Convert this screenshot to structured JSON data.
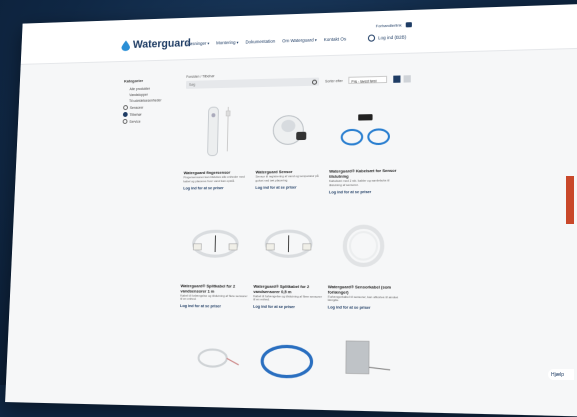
{
  "header": {
    "brand": "Waterguard",
    "nav": [
      {
        "label": "Løsninger",
        "caret": "▾"
      },
      {
        "label": "Montering",
        "caret": "▾"
      },
      {
        "label": "Dokumentation",
        "caret": ""
      },
      {
        "label": "Om Waterguard",
        "caret": "▾"
      },
      {
        "label": "Kontakt Os",
        "caret": ""
      }
    ],
    "util_link": "Forhandlerlink",
    "login_label": "Log ind (B2B)"
  },
  "breadcrumb": "Forsiden / Tilbehør",
  "sidebar": {
    "heading": "Kategorier",
    "items": [
      {
        "label": "Alle produkter",
        "indent": true,
        "selected": false
      },
      {
        "label": "Vandstopper",
        "indent": true,
        "selected": false
      },
      {
        "label": "Til udvidelsesenheder",
        "indent": true,
        "selected": false
      },
      {
        "label": "Sensorer",
        "indent": false,
        "selected": false
      },
      {
        "label": "Tilbehør",
        "indent": false,
        "selected": true
      },
      {
        "label": "Service",
        "indent": false,
        "selected": false
      }
    ]
  },
  "toolbar": {
    "search_placeholder": "Søg",
    "sort_label": "Sorter efter",
    "sort_value": "Pris - lavest først"
  },
  "products": [
    {
      "title": "Waterguard fingersensor",
      "desc": "Fingersensoren kan tilsluttes alle enheder med kabel og placeres hvor vand kan opstå.",
      "login": "Log ind for at se priser",
      "image": "finger-sensor"
    },
    {
      "title": "Waterguard Sensor",
      "desc": "Sensor til registrering af vand og temperatur på gulvet ved tæt placering.",
      "login": "Log ind for at se priser",
      "image": "round-sensor"
    },
    {
      "title": "Waterguard® Kabelsæt for Sensor tilslutning",
      "desc": "Kabelsæt med 2 stk. kabler og samleboks til tilslutning af sensorer.",
      "login": "Log ind for at se priser",
      "image": "cable-kit"
    },
    {
      "title": "Waterguard® Splitkabel for 2 vandsensorer 1 m",
      "desc": "Kabel til forlængelse og tilslutning af flere sensorer til en enhed.",
      "login": "Log ind for at se priser",
      "image": "split-cable-1"
    },
    {
      "title": "Waterguard® Splitkabel for 2 vandsensorer 0,5 m",
      "desc": "Kabel til forlængelse og tilslutning af flere sensorer til en enhed.",
      "login": "Log ind for at se priser",
      "image": "split-cable-2"
    },
    {
      "title": "Waterguard® Sensorkabel (som forlænger)",
      "desc": "Forlængerkabel til sensorer, kan afkortes til ønsket længde.",
      "login": "Log ind for at se priser",
      "image": "sensor-cable"
    },
    {
      "title": "",
      "desc": "",
      "login": "",
      "image": "wire-coil"
    },
    {
      "title": "",
      "desc": "",
      "login": "",
      "image": "blue-cable"
    },
    {
      "title": "",
      "desc": "",
      "login": "",
      "image": "box-module"
    }
  ],
  "chat_label": "Hjælp",
  "colors": {
    "brand": "#1e3c64",
    "accent": "#c9482a",
    "background": "#0f2744"
  }
}
